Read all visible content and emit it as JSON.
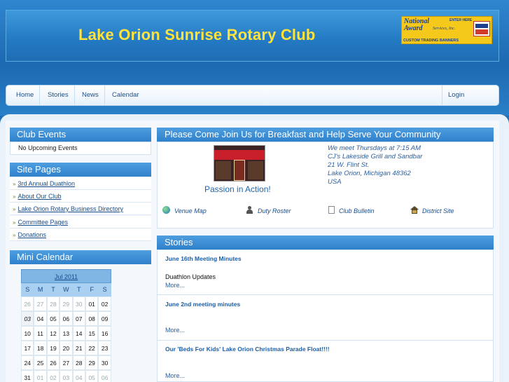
{
  "site": {
    "title": "Lake Orion Sunrise Rotary Club"
  },
  "ad": {
    "line1": "National",
    "line2": "Award",
    "services": "Services, Inc.",
    "enter": "ENTER HERE",
    "tagline": "CUSTOM TRADING BANNERS"
  },
  "nav": {
    "items": [
      "Home",
      "Stories",
      "News",
      "Calendar"
    ],
    "login": "Login"
  },
  "club_events": {
    "title": "Club Events",
    "empty": "No Upcoming Events"
  },
  "site_pages": {
    "title": "Site Pages",
    "links": [
      "3rd Annual Duathlon",
      "About Our Club",
      "Lake Orion Rotary Business Directory",
      "Committee Pages",
      "Donations"
    ]
  },
  "mini_calendar": {
    "title": "Mini Calendar",
    "month": "Jul 2011",
    "dow": [
      "S",
      "M",
      "T",
      "W",
      "T",
      "F",
      "S"
    ],
    "weeks": [
      [
        "26",
        "27",
        "28",
        "29",
        "30",
        "01",
        "02"
      ],
      [
        "03",
        "04",
        "05",
        "06",
        "07",
        "08",
        "09"
      ],
      [
        "10",
        "11",
        "12",
        "13",
        "14",
        "15",
        "16"
      ],
      [
        "17",
        "18",
        "19",
        "20",
        "21",
        "22",
        "23"
      ],
      [
        "24",
        "25",
        "26",
        "27",
        "28",
        "29",
        "30"
      ],
      [
        "31",
        "01",
        "02",
        "03",
        "04",
        "05",
        "06"
      ]
    ]
  },
  "welcome": {
    "title": "Please Come Join Us for Breakfast and Help Serve Your Community",
    "caption": "Passion in Action!",
    "address": [
      "We meet Thursdays at 7:15 AM",
      "CJ's Lakeside Grill and Sandbar",
      "21 W. Flint St.",
      "Lake Orion, Michigan 48362",
      "USA"
    ],
    "quick_links": [
      "Venue Map",
      "Duty Roster",
      "Club Bulletin",
      "District Site"
    ]
  },
  "stories": {
    "title": "Stories",
    "items": [
      {
        "title": "June 16th Meeting Minutes",
        "text": "Duathlon Updates",
        "more": "More..."
      },
      {
        "title": "June 2nd meeting minutes",
        "text": "",
        "more": "More..."
      },
      {
        "title": "Our 'Beds For Kids' Lake Orion Christmas Parade Float!!!!",
        "text": "",
        "more": "More..."
      }
    ]
  }
}
